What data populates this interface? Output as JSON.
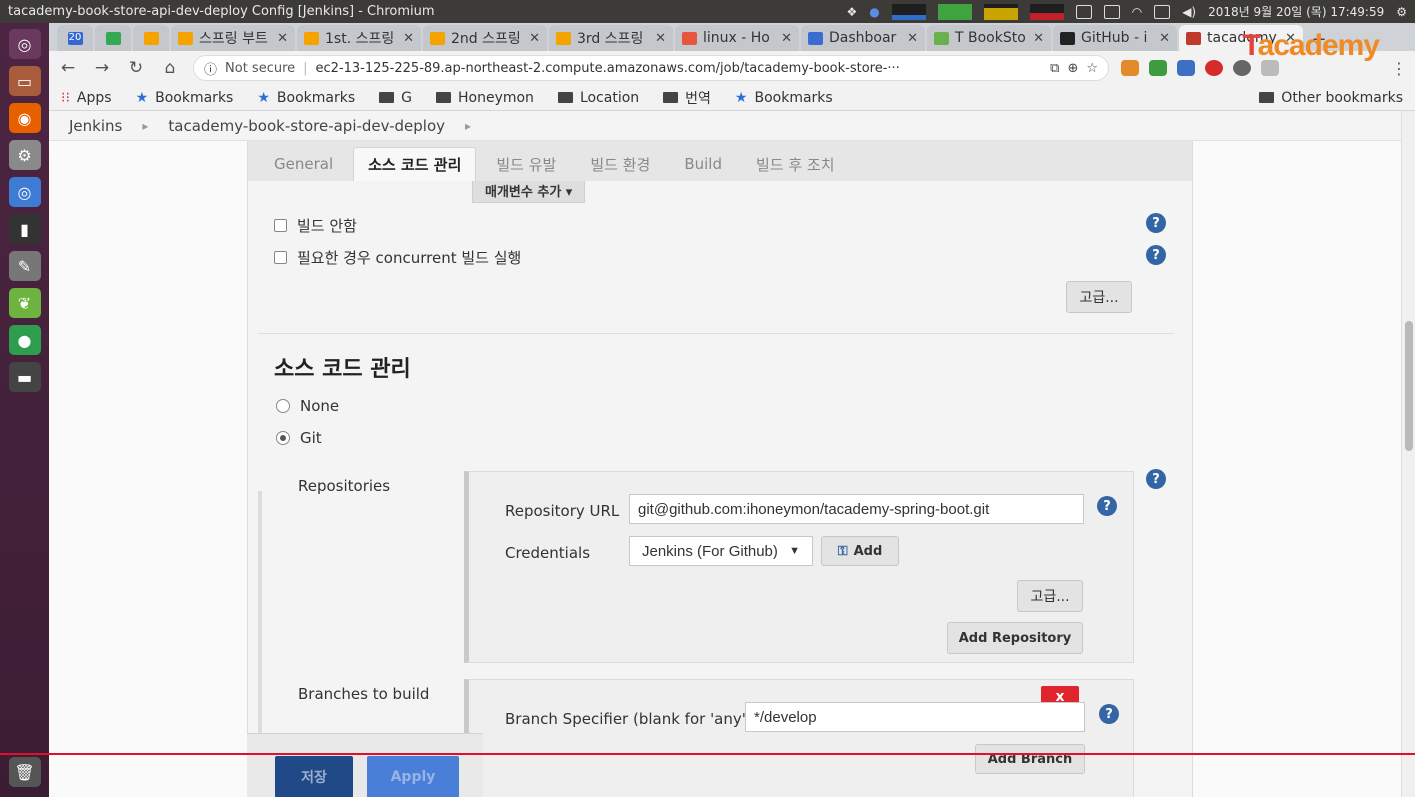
{
  "os": {
    "window_title": "tacademy-book-store-api-dev-deploy Config [Jenkins] - Chromium",
    "clock": "2018년 9월 20일 (목) 17:49:59"
  },
  "browser": {
    "tabs": [
      {
        "label": "20",
        "icon_color": "#3367d6"
      },
      {
        "label": "",
        "icon_color": "#34a853"
      },
      {
        "label": "",
        "icon_color": "#f4a300"
      },
      {
        "label": "스프링 부트",
        "icon_color": "#f4a300"
      },
      {
        "label": "1st. 스프링",
        "icon_color": "#f4a300"
      },
      {
        "label": "2nd 스프링",
        "icon_color": "#f4a300"
      },
      {
        "label": "3rd 스프링",
        "icon_color": "#f4a300"
      },
      {
        "label": "linux - Ho",
        "icon_color": "#e8553d"
      },
      {
        "label": "Dashboar",
        "icon_color": "#3b6ccf"
      },
      {
        "label": "T BookSto",
        "icon_color": "#6ab04c"
      },
      {
        "label": "GitHub - i",
        "icon_color": "#222222"
      },
      {
        "label": "tacademy",
        "icon_color": "#c0392b"
      }
    ],
    "brand_text_t": "T",
    "brand_text_rest": "academy",
    "secure_label": "Not secure",
    "url": "ec2-13-125-225-89.ap-northeast-2.compute.amazonaws.com/job/tacademy-book-store-···",
    "bookmarks": {
      "apps": "Apps",
      "b1": "Bookmarks",
      "b2": "Bookmarks",
      "g": "G",
      "honeymon": "Honeymon",
      "location": "Location",
      "translate": "번역",
      "b3": "Bookmarks",
      "other": "Other bookmarks"
    }
  },
  "jenkins": {
    "breadcrumb": {
      "root": "Jenkins",
      "job": "tacademy-book-store-api-dev-deploy"
    },
    "config_tabs": {
      "general": "General",
      "scm": "소스 코드 관리",
      "triggers": "빌드 유발",
      "env": "빌드 환경",
      "build": "Build",
      "post": "빌드 후 조치"
    },
    "param_button": "매개변수 추가 ▾",
    "options": {
      "disable_build": "빌드 안함",
      "concurrent": "필요한 경우 concurrent 빌드 실행"
    },
    "advanced_label": "고급...",
    "scm_title": "소스 코드 관리",
    "scm_none": "None",
    "scm_git": "Git",
    "repositories_label": "Repositories",
    "repo_url_label": "Repository URL",
    "repo_url_value": "git@github.com:ihoneymon/tacademy-spring-boot.git",
    "credentials_label": "Credentials",
    "credentials_value": "Jenkins (For Github)",
    "add_label": "Add",
    "add_repository": "Add Repository",
    "branches_label": "Branches to build",
    "branch_spec_label": "Branch Specifier (blank for 'any')",
    "branch_spec_value": "*/develop",
    "delete_label": "x",
    "add_branch": "Add Branch",
    "save": "저장",
    "apply": "Apply",
    "help": "?"
  }
}
